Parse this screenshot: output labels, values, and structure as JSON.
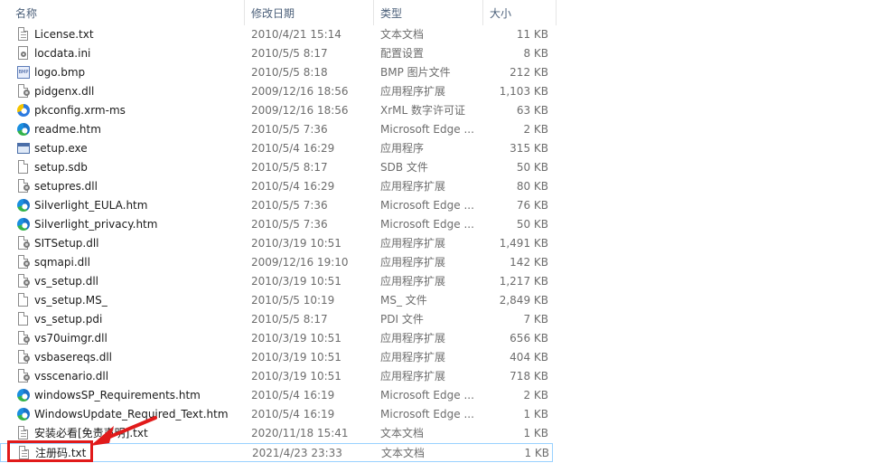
{
  "columns": {
    "name": "名称",
    "date": "修改日期",
    "type": "类型",
    "size": "大小"
  },
  "files": [
    {
      "name": "License.txt",
      "date": "2010/4/21 15:14",
      "type": "文本文档",
      "size": "11 KB",
      "icon": "text-file-icon"
    },
    {
      "name": "locdata.ini",
      "date": "2010/5/5 8:17",
      "type": "配置设置",
      "size": "8 KB",
      "icon": "config-file-icon"
    },
    {
      "name": "logo.bmp",
      "date": "2010/5/5 8:18",
      "type": "BMP 图片文件",
      "size": "212 KB",
      "icon": "bmp-file-icon"
    },
    {
      "name": "pidgenx.dll",
      "date": "2009/12/16 18:56",
      "type": "应用程序扩展",
      "size": "1,103 KB",
      "icon": "dll-file-icon"
    },
    {
      "name": "pkconfig.xrm-ms",
      "date": "2009/12/16 18:56",
      "type": "XrML 数字许可证",
      "size": "63 KB",
      "icon": "xrm-file-icon"
    },
    {
      "name": "readme.htm",
      "date": "2010/5/5 7:36",
      "type": "Microsoft Edge ...",
      "size": "2 KB",
      "icon": "edge-html-icon"
    },
    {
      "name": "setup.exe",
      "date": "2010/5/4 16:29",
      "type": "应用程序",
      "size": "315 KB",
      "icon": "exe-file-icon"
    },
    {
      "name": "setup.sdb",
      "date": "2010/5/5 8:17",
      "type": "SDB 文件",
      "size": "50 KB",
      "icon": "blank-file-icon"
    },
    {
      "name": "setupres.dll",
      "date": "2010/5/4 16:29",
      "type": "应用程序扩展",
      "size": "80 KB",
      "icon": "dll-file-icon"
    },
    {
      "name": "Silverlight_EULA.htm",
      "date": "2010/5/5 7:36",
      "type": "Microsoft Edge ...",
      "size": "76 KB",
      "icon": "edge-html-icon"
    },
    {
      "name": "Silverlight_privacy.htm",
      "date": "2010/5/5 7:36",
      "type": "Microsoft Edge ...",
      "size": "50 KB",
      "icon": "edge-html-icon"
    },
    {
      "name": "SITSetup.dll",
      "date": "2010/3/19 10:51",
      "type": "应用程序扩展",
      "size": "1,491 KB",
      "icon": "dll-file-icon"
    },
    {
      "name": "sqmapi.dll",
      "date": "2009/12/16 19:10",
      "type": "应用程序扩展",
      "size": "142 KB",
      "icon": "dll-file-icon"
    },
    {
      "name": "vs_setup.dll",
      "date": "2010/3/19 10:51",
      "type": "应用程序扩展",
      "size": "1,217 KB",
      "icon": "dll-file-icon"
    },
    {
      "name": "vs_setup.MS_",
      "date": "2010/5/5 10:19",
      "type": "MS_ 文件",
      "size": "2,849 KB",
      "icon": "blank-file-icon"
    },
    {
      "name": "vs_setup.pdi",
      "date": "2010/5/5 8:17",
      "type": "PDI 文件",
      "size": "7 KB",
      "icon": "blank-file-icon"
    },
    {
      "name": "vs70uimgr.dll",
      "date": "2010/3/19 10:51",
      "type": "应用程序扩展",
      "size": "656 KB",
      "icon": "dll-file-icon"
    },
    {
      "name": "vsbasereqs.dll",
      "date": "2010/3/19 10:51",
      "type": "应用程序扩展",
      "size": "404 KB",
      "icon": "dll-file-icon"
    },
    {
      "name": "vsscenario.dll",
      "date": "2010/3/19 10:51",
      "type": "应用程序扩展",
      "size": "718 KB",
      "icon": "dll-file-icon"
    },
    {
      "name": "windowsSP_Requirements.htm",
      "date": "2010/5/4 16:19",
      "type": "Microsoft Edge ...",
      "size": "2 KB",
      "icon": "edge-html-icon"
    },
    {
      "name": "WindowsUpdate_Required_Text.htm",
      "date": "2010/5/4 16:19",
      "type": "Microsoft Edge ...",
      "size": "1 KB",
      "icon": "edge-html-icon"
    },
    {
      "name": "安装必看[免责声明].txt",
      "date": "2020/11/18 15:41",
      "type": "文本文档",
      "size": "1 KB",
      "icon": "text-file-icon"
    },
    {
      "name": "注册码.txt",
      "date": "2021/4/23 23:33",
      "type": "文本文档",
      "size": "1 KB",
      "icon": "text-file-icon"
    }
  ],
  "selected_index": 22,
  "colors": {
    "annotation": "#e11a1a",
    "selection_border": "#99d1ff",
    "header_text": "#4c607a"
  }
}
